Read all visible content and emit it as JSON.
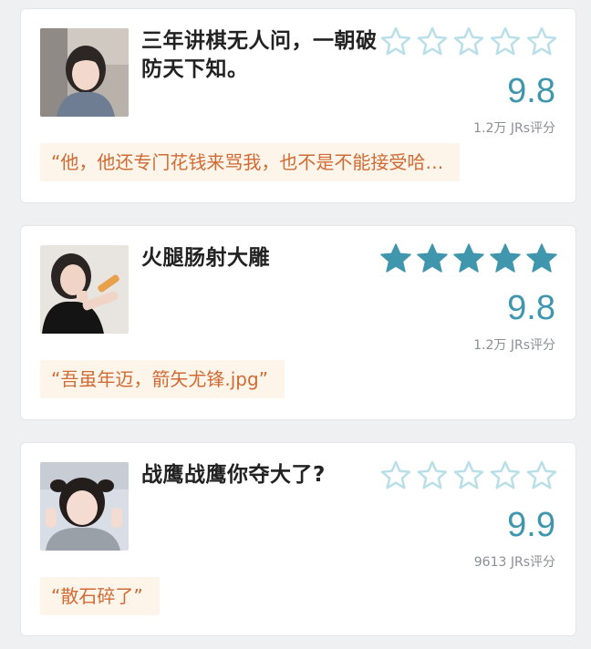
{
  "colors": {
    "accent": "#3f96ad",
    "star_outline": "#b9dfe8",
    "star_filled": "#3f96ad",
    "quote_text": "#d06b34",
    "quote_bg": "#fdf4ea"
  },
  "items": [
    {
      "title": "三年讲棋无人问，一朝破防天下知。",
      "rating_filled": false,
      "stars_filled": 0,
      "stars_total": 5,
      "score": "9.8",
      "count": "1.2万 JRs评分",
      "quote": "“他，他还专门花钱来骂我，也不是不能接受哈…",
      "avatar_icon": "avatar-photo"
    },
    {
      "title": "火腿肠射大雕",
      "rating_filled": true,
      "stars_filled": 5,
      "stars_total": 5,
      "score": "9.8",
      "count": "1.2万 JRs评分",
      "quote": "“吾虽年迈，箭矢尤锋.jpg”",
      "avatar_icon": "avatar-photo"
    },
    {
      "title": "战鹰战鹰你夺大了?",
      "rating_filled": false,
      "stars_filled": 0,
      "stars_total": 5,
      "score": "9.9",
      "count": "9613 JRs评分",
      "quote": "“散石碎了”",
      "avatar_icon": "avatar-photo"
    }
  ]
}
